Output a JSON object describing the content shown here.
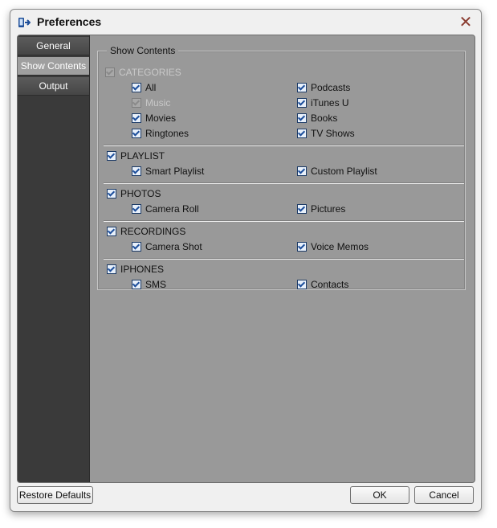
{
  "window": {
    "title": "Preferences",
    "close_symbol": "✕"
  },
  "sidebar": {
    "items": [
      {
        "label": "General",
        "active": false
      },
      {
        "label": "Show Contents",
        "active": true
      },
      {
        "label": "Output",
        "active": false
      }
    ]
  },
  "show_contents": {
    "legend": "Show Contents",
    "categories": {
      "label": "CATEGORIES",
      "checked": true,
      "disabled": true,
      "items": {
        "all": {
          "label": "All",
          "checked": true
        },
        "music": {
          "label": "Music",
          "checked": true,
          "disabled": true
        },
        "movies": {
          "label": "Movies",
          "checked": true
        },
        "ringtones": {
          "label": "Ringtones",
          "checked": true
        },
        "podcasts": {
          "label": "Podcasts",
          "checked": true
        },
        "itunes_u": {
          "label": "iTunes U",
          "checked": true
        },
        "books": {
          "label": "Books",
          "checked": true
        },
        "tv_shows": {
          "label": "TV Shows",
          "checked": true
        }
      }
    },
    "playlist": {
      "label": "PLAYLIST",
      "checked": true,
      "items": {
        "smart_playlist": {
          "label": "Smart Playlist",
          "checked": true
        },
        "custom_playlist": {
          "label": "Custom Playlist",
          "checked": true
        }
      }
    },
    "photos": {
      "label": "PHOTOS",
      "checked": true,
      "items": {
        "camera_roll": {
          "label": "Camera Roll",
          "checked": true
        },
        "pictures": {
          "label": "Pictures",
          "checked": true
        }
      }
    },
    "recordings": {
      "label": "RECORDINGS",
      "checked": true,
      "items": {
        "camera_shot": {
          "label": "Camera Shot",
          "checked": true
        },
        "voice_memos": {
          "label": "Voice Memos",
          "checked": true
        }
      }
    },
    "iphones": {
      "label": "IPHONES",
      "checked": true,
      "items": {
        "sms": {
          "label": "SMS",
          "checked": true
        },
        "contacts": {
          "label": "Contacts",
          "checked": true
        }
      }
    }
  },
  "footer": {
    "restore_label": "Restore Defaults",
    "ok_label": "OK",
    "cancel_label": "Cancel"
  },
  "colors": {
    "panel_bg": "#999999",
    "sidebar_bg": "#3a3a3a",
    "checkbox_blue": "#1d4f9c",
    "close_red": "#8a3c30"
  }
}
